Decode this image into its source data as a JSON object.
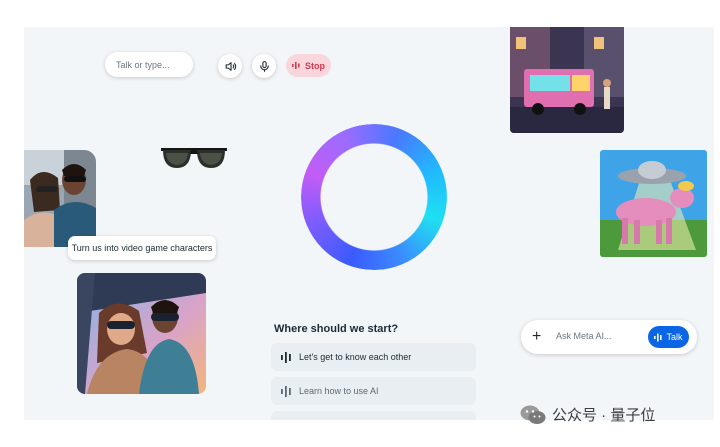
{
  "toolbar": {
    "input_placeholder": "Talk or type...",
    "speaker_icon": "speaker-icon",
    "mic_icon": "mic-icon",
    "stop_label": "Stop",
    "stop_color": "#d43b52"
  },
  "prompt_bubble": {
    "text": "Turn us into video game characters"
  },
  "starter": {
    "heading": "Where should we start?",
    "suggestions": [
      {
        "label": "Let's get to know each other"
      },
      {
        "label": "Learn how to use AI"
      }
    ]
  },
  "ask_bar": {
    "add_icon": "plus-icon",
    "placeholder": "Ask Meta AI...",
    "talk_label": "Talk",
    "accent": "#0a66e4"
  },
  "watermark": {
    "text": "公众号 · 量子位"
  }
}
